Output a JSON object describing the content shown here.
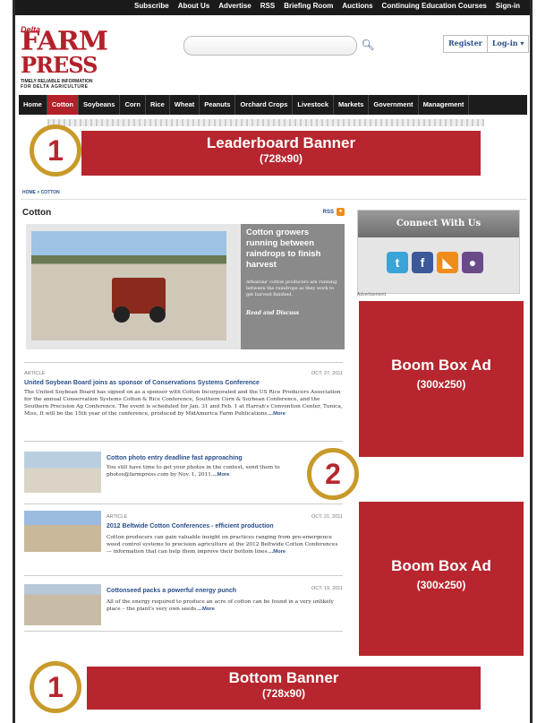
{
  "topbar": [
    "Subscribe",
    "About Us",
    "Advertise",
    "RSS",
    "Briefing Room",
    "Auctions",
    "Continuing Education Courses",
    "Sign-in"
  ],
  "logo": {
    "delta": "Delta",
    "farm": "FARM",
    "press": "PRESS",
    "tagline1": "TIMELY RELIABLE INFORMATION",
    "tagline2": "FOR DELTA AGRICULTURE"
  },
  "header": {
    "register": "Register",
    "login": "Log-in ▾"
  },
  "nav": [
    "Home",
    "Cotton",
    "Soybeans",
    "Corn",
    "Rice",
    "Wheat",
    "Peanuts",
    "Orchard Crops",
    "Livestock",
    "Markets",
    "Government",
    "Management"
  ],
  "nav_active": 1,
  "leaderboard": {
    "title": "Leaderboard Banner",
    "size": "(728x90)",
    "badge": "1"
  },
  "breadcrumb": "HOME > COTTON",
  "section": {
    "title": "Cotton",
    "rss": "RSS"
  },
  "featured": {
    "title": "Cotton growers running between raindrops to finish harvest",
    "summary": "Arkansas' cotton producers are running between the raindrops as they work to get harvest finished.",
    "cta": "Read and Discuss"
  },
  "articles": [
    {
      "label": "ARTICLE",
      "date": "OCT. 27, 2011",
      "title": "United Soybean Board joins as sponsor of Conservations Systems Conference",
      "body": "The United Soybean Board has signed on as a sponsor with Cotton Incorporated and the US Rice Producers Association for the annual Conservation Systems Cotton & Rice Conference, Southern Corn & Soybean Conference, and the Southern Precision Ag Conference. The event is scheduled for Jan. 31 and Feb. 1 at Harrah's Convention Center, Tunica, Miss. It will be the 15th year of the conference, produced by MidAmerica Farm Publications.",
      "more": "...More"
    },
    {
      "label": "",
      "date": "",
      "title": "Cotton photo entry deadline fast approaching",
      "body": "You still have time to get your photos in the contest, send them to photos@farmpress.com by Nov. 1, 2011.",
      "more": "...More"
    },
    {
      "label": "ARTICLE",
      "date": "OCT. 21, 2011",
      "title": "2012 Beltwide Cotton Conferences - efficient production",
      "body": "Cotton producers can gain valuable insight on practices ranging from pre-emergence weed control systems to precision agriculture at the 2012 Beltwide Cotton Conferences — information that can help them improve their bottom lines.",
      "more": "...More"
    },
    {
      "label": "",
      "date": "OCT. 19, 2011",
      "title": "Cottonseed packs a powerful energy punch",
      "body": "All of the energy required to produce an acre of cotton can be found in a very unlikely place – the plant's very own seeds.",
      "more": "...More"
    }
  ],
  "connect": {
    "title": "Connect With Us",
    "icons": [
      "twitter-icon",
      "facebook-icon",
      "rss-icon",
      "podcast-icon"
    ]
  },
  "advertisement_label": "Advertisement",
  "boombox": {
    "title": "Boom Box Ad",
    "size": "(300x250)",
    "badge": "2"
  },
  "bottom": {
    "title": "Bottom Banner",
    "size": "(728x90)",
    "badge": "1"
  },
  "colors": {
    "accent": "#b7262e",
    "badge_ring": "#c89a2a",
    "link": "#2a4f8a",
    "nav_bg": "#1c1c1c"
  }
}
